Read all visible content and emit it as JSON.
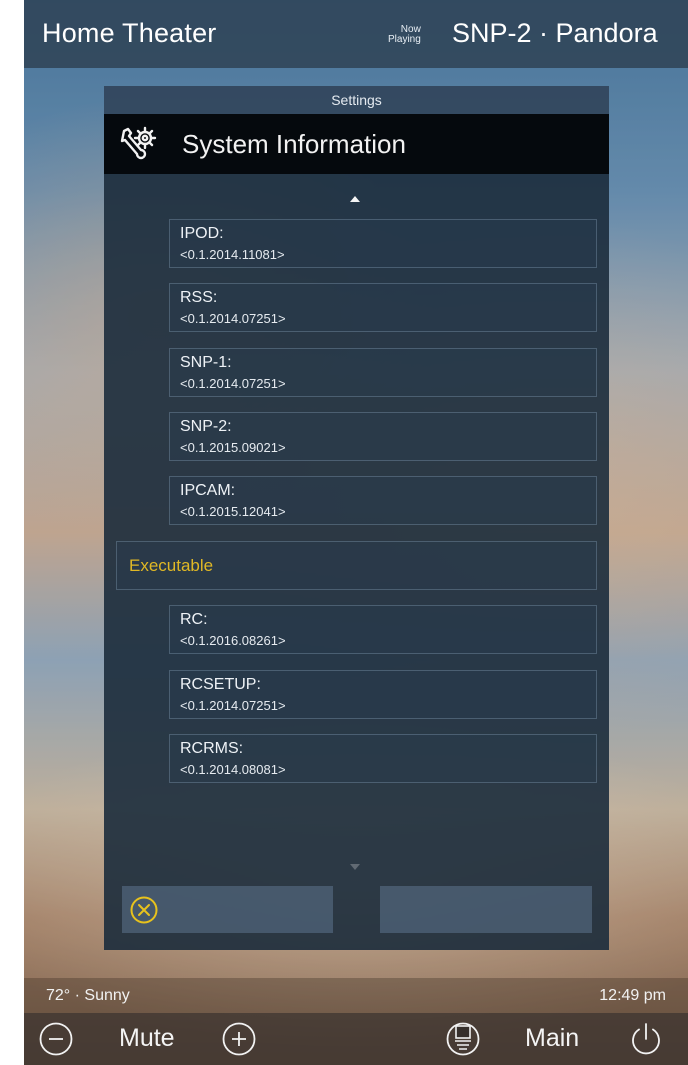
{
  "header": {
    "title": "Home Theater",
    "now_playing_line1": "Now",
    "now_playing_line2": "Playing",
    "source": "SNP-2 · Pandora"
  },
  "panel": {
    "caption": "Settings",
    "title": "System Information",
    "title_icon": "wrench-gear-icon",
    "items": [
      {
        "name": "IPOD:",
        "version": "<0.1.2014.11081>"
      },
      {
        "name": "RSS:",
        "version": "<0.1.2014.07251>"
      },
      {
        "name": "SNP-1:",
        "version": "<0.1.2014.07251>"
      },
      {
        "name": "SNP-2:",
        "version": "<0.1.2015.09021>"
      },
      {
        "name": "IPCAM:",
        "version": "<0.1.2015.12041>"
      }
    ],
    "section": "Executable",
    "section_color": "#e0b825",
    "exec_items": [
      {
        "name": "RC:",
        "version": "<0.1.2016.08261>"
      },
      {
        "name": "RCSETUP:",
        "version": "<0.1.2014.07251>"
      },
      {
        "name": "RCRMS:",
        "version": "<0.1.2014.08081>"
      }
    ],
    "cancel_icon": "close-circle-icon"
  },
  "status": {
    "weather": "72° · Sunny",
    "time": "12:49 pm"
  },
  "controls": {
    "mute_label": "Mute",
    "main_label": "Main",
    "icons": [
      "volume-down-icon",
      "volume-up-icon",
      "menu-list-icon",
      "power-icon"
    ]
  }
}
